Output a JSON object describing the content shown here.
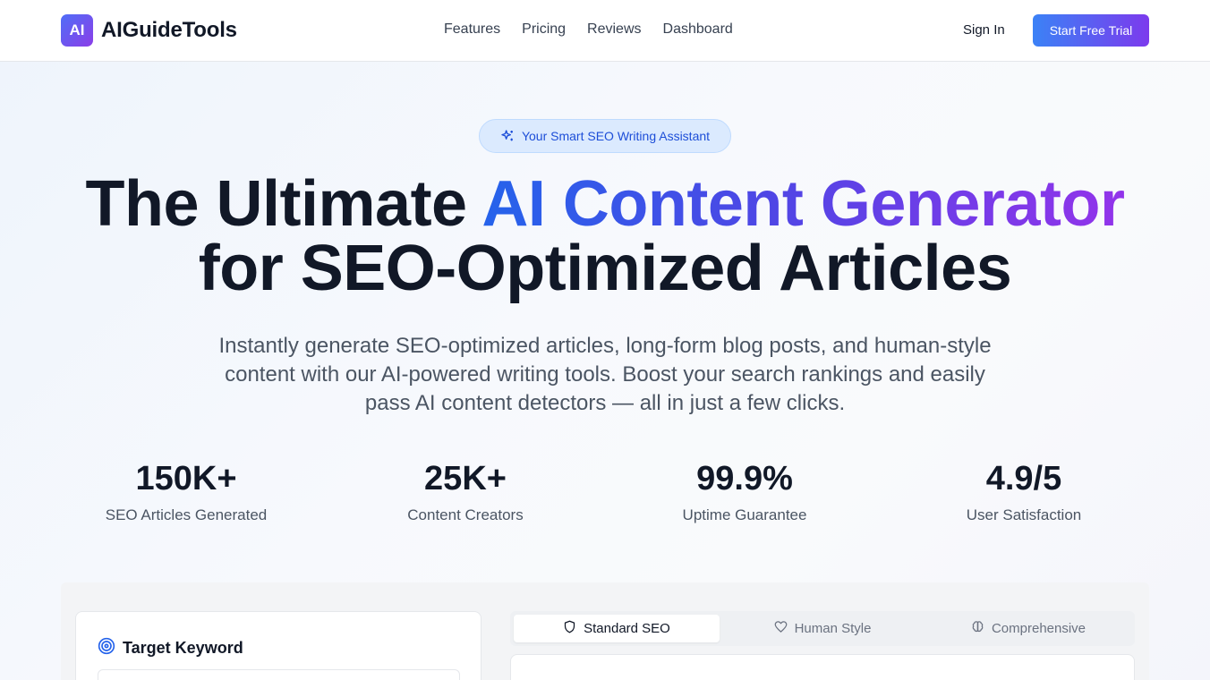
{
  "brand": {
    "badge": "AI",
    "name": "AIGuideTools",
    "gradient": [
      "#4f6ef7",
      "#8b3ee8"
    ]
  },
  "nav": {
    "items": [
      "Features",
      "Pricing",
      "Reviews",
      "Dashboard"
    ]
  },
  "header": {
    "signin_label": "Sign In",
    "trial_label": "Start Free Trial"
  },
  "hero": {
    "pill_label": "Your Smart SEO Writing Assistant",
    "headline_part1": "The Ultimate ",
    "headline_highlight": "AI Content Generator",
    "headline_part2": "for SEO-Optimized Articles",
    "subtext": "Instantly generate SEO-optimized articles, long-form blog posts, and human-style content with our AI-powered writing tools. Boost your search rankings and easily pass AI content detectors — all in just a few clicks."
  },
  "stats": [
    {
      "value": "150K+",
      "label": "SEO Articles Generated"
    },
    {
      "value": "25K+",
      "label": "Content Creators"
    },
    {
      "value": "99.9%",
      "label": "Uptime Guarantee"
    },
    {
      "value": "4.9/5",
      "label": "User Satisfaction"
    }
  ],
  "generator": {
    "keyword_title": "Target Keyword",
    "tabs": [
      {
        "label": "Standard SEO",
        "icon": "shield-icon",
        "active": true
      },
      {
        "label": "Human Style",
        "icon": "heart-icon",
        "active": false
      },
      {
        "label": "Comprehensive",
        "icon": "brain-icon",
        "active": false
      }
    ]
  },
  "colors": {
    "accent_blue": "#3b82f6",
    "accent_purple": "#7c3aed",
    "text_dark": "#111827"
  }
}
